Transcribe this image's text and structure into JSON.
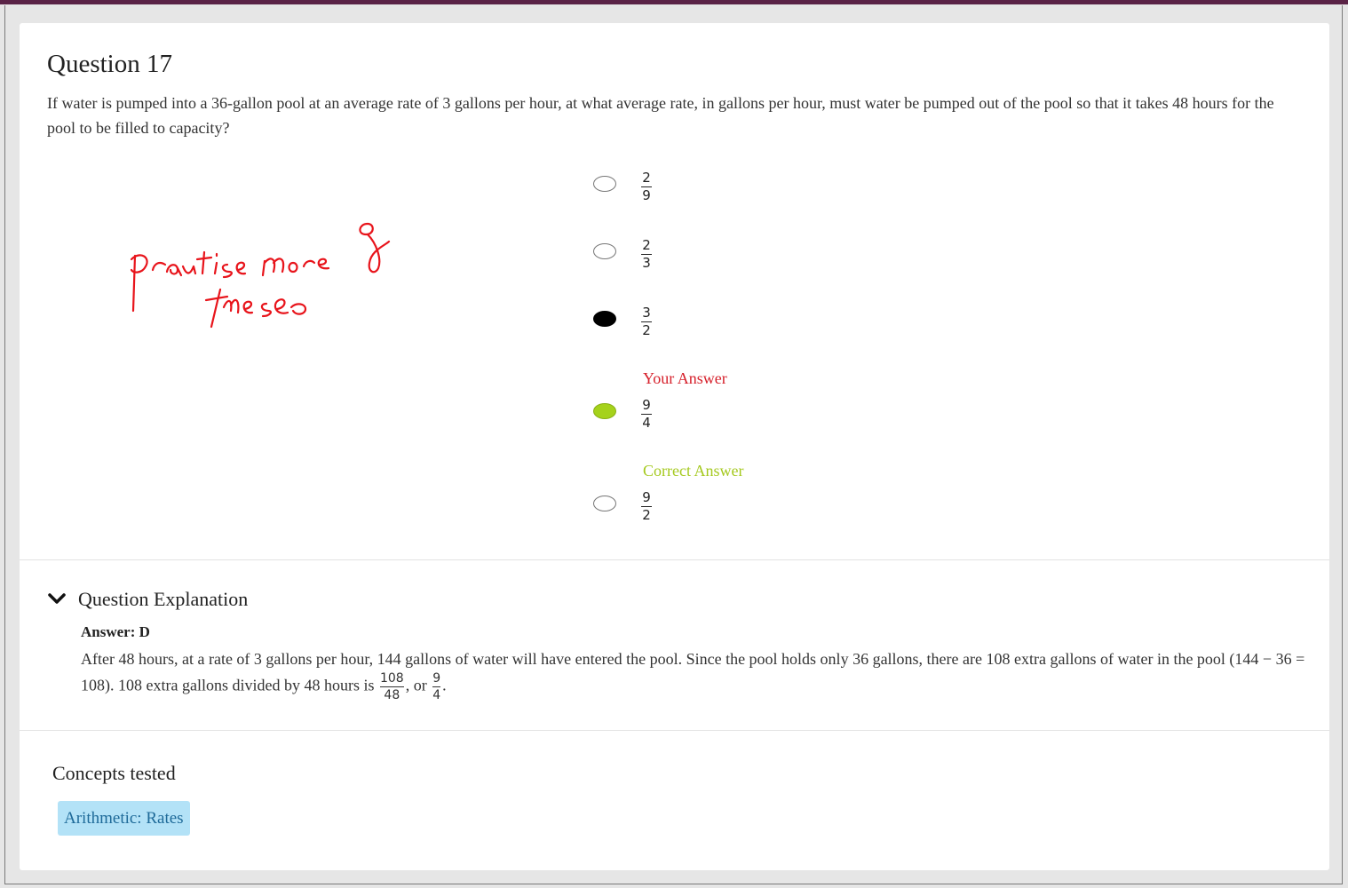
{
  "question": {
    "title": "Question 17",
    "text": "If water is pumped into a 36-gallon pool at an average rate of 3 gallons per hour, at what average rate, in gallons per hour, must water be pumped out of the pool so that it takes 48 hours for the pool to be filled to capacity?"
  },
  "options": [
    {
      "num": "2",
      "den": "9",
      "state": "empty"
    },
    {
      "num": "2",
      "den": "3",
      "state": "empty"
    },
    {
      "num": "3",
      "den": "2",
      "state": "selected"
    },
    {
      "num": "9",
      "den": "4",
      "state": "correct"
    },
    {
      "num": "9",
      "den": "2",
      "state": "empty"
    }
  ],
  "labels": {
    "your_answer": "Your Answer",
    "correct_answer": "Correct Answer"
  },
  "annotation": {
    "handwritten_note": "practise more of these",
    "color": "#e8141b"
  },
  "explanation": {
    "heading": "Question Explanation",
    "answer": "Answer: D",
    "text_part1": "After 48 hours, at a rate of 3 gallons per hour, 144 gallons of water will have entered the pool. Since the pool holds only 36 gallons, there are 108 extra gallons of water in the pool (144 − 36 = 108). 108 extra gallons divided by 48 hours is",
    "frac1_num": "108",
    "frac1_den": "48",
    "text_part2": ", or",
    "frac2_num": "9",
    "frac2_den": "4",
    "text_part3": "."
  },
  "concepts": {
    "title": "Concepts tested",
    "tag": "Arithmetic: Rates"
  },
  "colors": {
    "wrong": "#d6202b",
    "correct": "#a5d21b",
    "tag_bg": "#b3e2f7",
    "tag_text": "#1e6a99",
    "top_bar": "#5a2346"
  }
}
